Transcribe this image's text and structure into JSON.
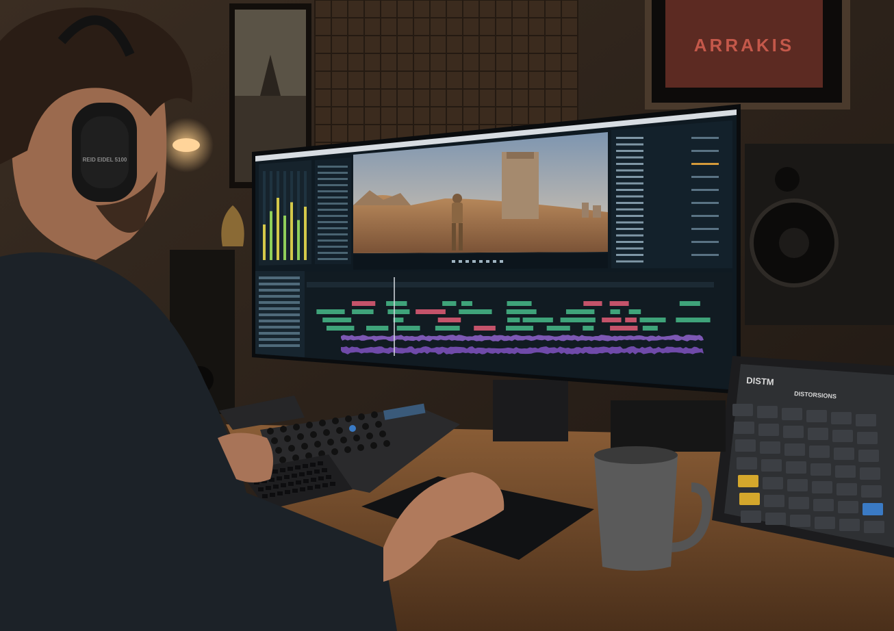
{
  "poster": {
    "title": "ARRAKIS"
  },
  "headphones": {
    "brand_text": "REID EIDEL 5100"
  },
  "tablet": {
    "label": "DISTM",
    "subtitle": "DISTORSIONS"
  },
  "colors": {
    "wall": "#2a211a",
    "desk": "#7a5230",
    "screen_bg": "#0f1a22",
    "timeline_green": "#3fa37a",
    "timeline_pink": "#c4536a",
    "audio_purple": "#8a5fc4",
    "tablet_accent": "#d4a72c"
  },
  "icons": [
    "headphones-icon",
    "mouse-icon",
    "speaker-icon"
  ]
}
